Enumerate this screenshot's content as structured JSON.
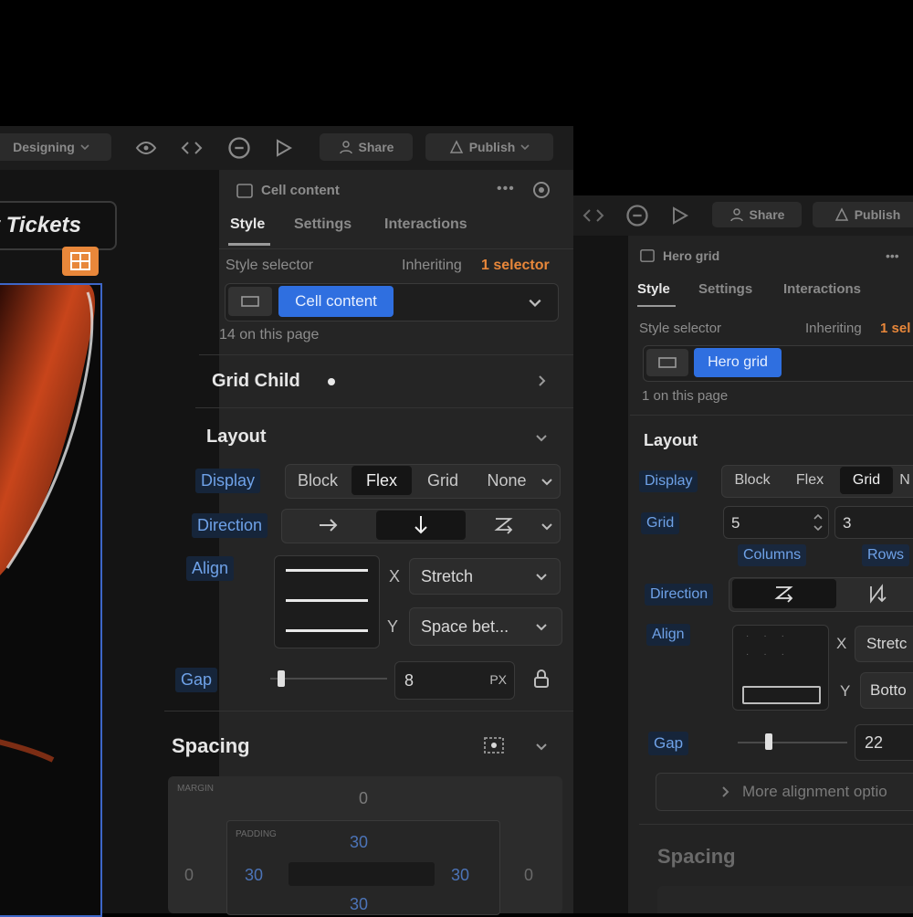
{
  "toolbar_left": {
    "mode": "Designing",
    "share": "Share",
    "publish": "Publish"
  },
  "toolbar_right": {
    "share": "Share",
    "publish": "Publish"
  },
  "canvas": {
    "heading": "t Tickets"
  },
  "left_panel": {
    "element_name": "Cell content",
    "tabs": [
      "Style",
      "Settings",
      "Interactions"
    ],
    "style_selector_label": "Style selector",
    "inheriting_prefix": "Inheriting",
    "inheriting_count": "1 selector",
    "selector_chip": "Cell content",
    "on_page": "14 on this page",
    "grid_child": "Grid Child",
    "layout_title": "Layout",
    "display_label": "Display",
    "display_options": [
      "Block",
      "Flex",
      "Grid",
      "None"
    ],
    "display_selected": "Flex",
    "direction_label": "Direction",
    "align_label": "Align",
    "align_x_label": "X",
    "align_x_value": "Stretch",
    "align_y_label": "Y",
    "align_y_value": "Space bet...",
    "gap_label": "Gap",
    "gap_value": "8",
    "gap_unit": "PX",
    "spacing_title": "Spacing",
    "margin_label": "MARGIN",
    "padding_label": "PADDING",
    "margin_top": "0",
    "margin_left": "0",
    "margin_right": "0",
    "padding_top": "30",
    "padding_left": "30",
    "padding_right": "30",
    "padding_bottom": "30"
  },
  "right_panel": {
    "element_name": "Hero grid",
    "tabs": [
      "Style",
      "Settings",
      "Interactions"
    ],
    "style_selector_label": "Style selector",
    "inheriting_prefix": "Inheriting",
    "inheriting_count": "1 sel",
    "selector_chip": "Hero grid",
    "on_page": "1 on this page",
    "layout_title": "Layout",
    "display_label": "Display",
    "display_options": [
      "Block",
      "Flex",
      "Grid",
      "N"
    ],
    "display_selected": "Grid",
    "grid_label": "Grid",
    "columns_value": "5",
    "rows_value": "3",
    "columns_label": "Columns",
    "rows_label": "Rows",
    "direction_label": "Direction",
    "align_label": "Align",
    "align_x_label": "X",
    "align_x_value": "Stretc",
    "align_y_label": "Y",
    "align_y_value": "Botto",
    "gap_label": "Gap",
    "gap_value": "22",
    "more_alignment": "More alignment optio",
    "spacing_title": "Spacing"
  },
  "colors": {
    "accent_blue": "#2f6fe0",
    "orange": "#e8873a",
    "label_blue": "#6fa2e8"
  }
}
